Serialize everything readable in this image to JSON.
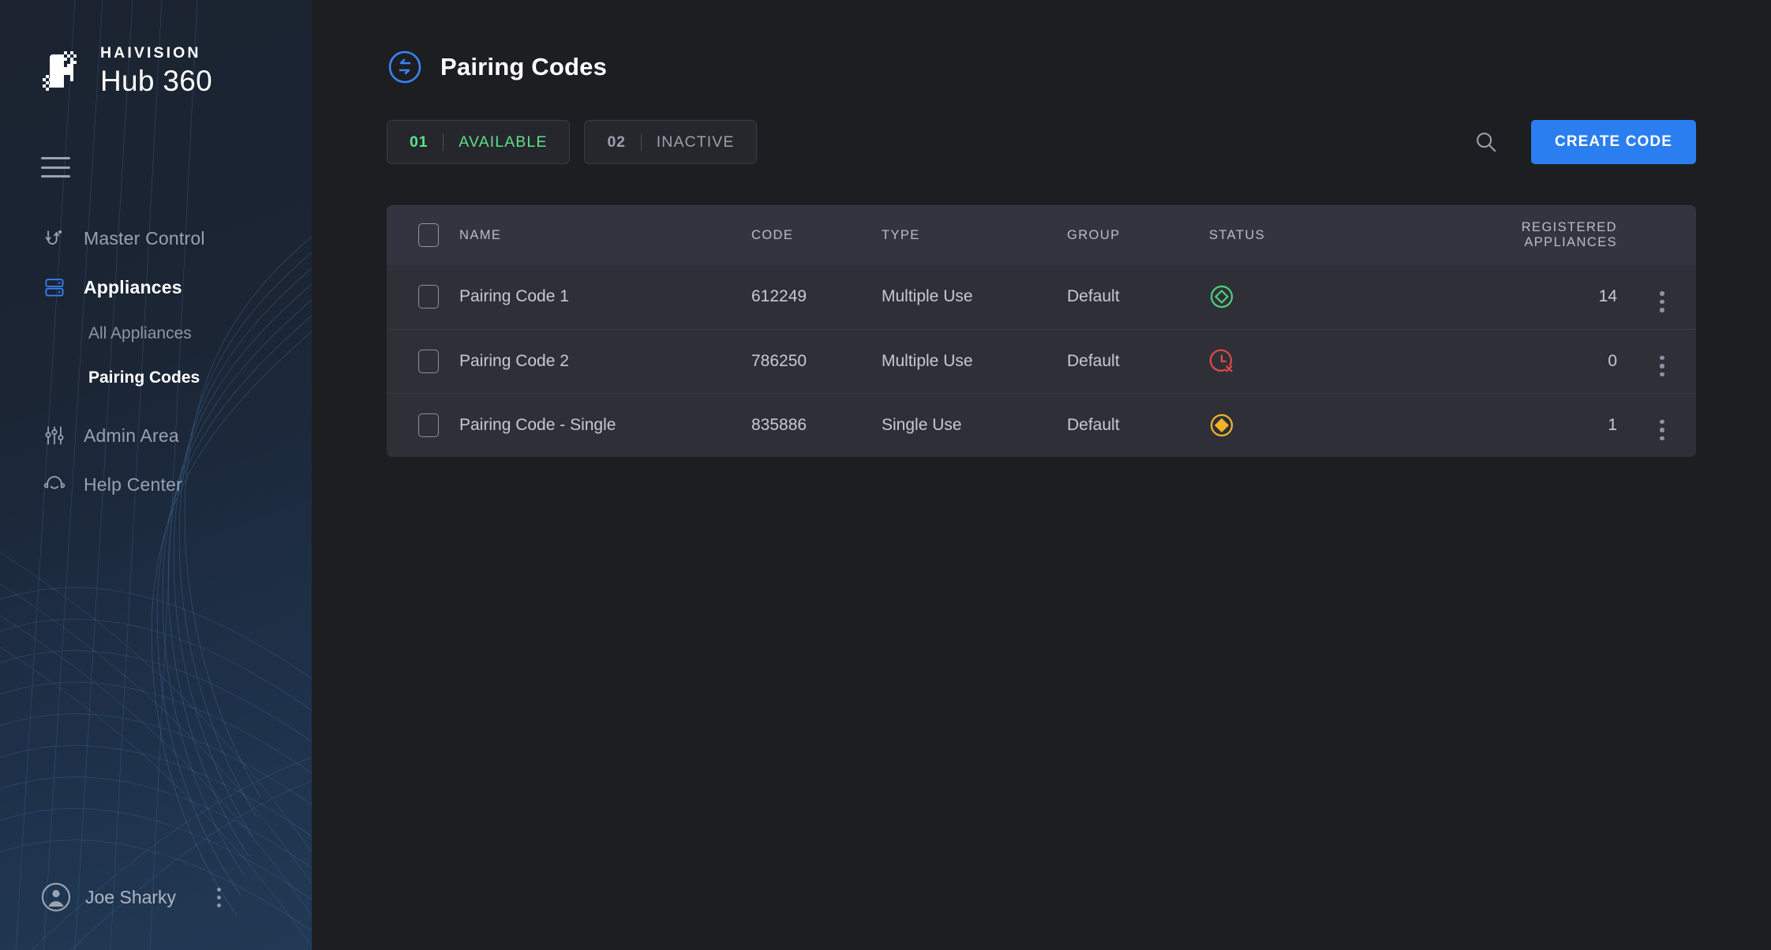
{
  "sidebar": {
    "logo": {
      "brand": "HAIVISION",
      "product": "Hub 360",
      "mark_icon": "haivision-h-logo"
    },
    "menu_toggle_icon": "hamburger-menu-icon",
    "items": [
      {
        "label": "Master Control",
        "icon": "routing-swap-icon",
        "active": false
      },
      {
        "label": "Appliances",
        "icon": "server-stack-icon",
        "active": true
      },
      {
        "label": "Admin Area",
        "icon": "sliders-icon",
        "active": false
      },
      {
        "label": "Help Center",
        "icon": "headset-icon",
        "active": false
      }
    ],
    "sub_items": [
      {
        "label": "All Appliances",
        "active": false
      },
      {
        "label": "Pairing Codes",
        "active": true
      }
    ],
    "user": {
      "name": "Joe Sharky",
      "avatar_icon": "user-avatar-icon",
      "menu_icon": "kebab-menu-icon"
    }
  },
  "header": {
    "title": "Pairing Codes",
    "icon": "pairing-exchange-icon"
  },
  "toolbar": {
    "chips": [
      {
        "count": "01",
        "label": "AVAILABLE",
        "color": "#5ce08b"
      },
      {
        "count": "02",
        "label": "INACTIVE",
        "color": "#9aa0ad"
      }
    ],
    "search_icon": "search-icon",
    "create_label": "CREATE CODE",
    "create_color": "#2b7ef0"
  },
  "table": {
    "columns": [
      "NAME",
      "CODE",
      "TYPE",
      "GROUP",
      "STATUS",
      "REGISTERED APPLIANCES"
    ],
    "select_all_icon": "checkbox-unchecked-icon",
    "rows": [
      {
        "name": "Pairing Code 1",
        "code": "612249",
        "type": "Multiple Use",
        "group": "Default",
        "status": "active",
        "status_icon": "diamond-outline-circle-icon",
        "status_color": "#4ed07e",
        "registered": "14",
        "menu_icon": "kebab-menu-icon"
      },
      {
        "name": "Pairing Code 2",
        "code": "786250",
        "type": "Multiple Use",
        "group": "Default",
        "status": "expired",
        "status_icon": "clock-x-icon",
        "status_color": "#e04a4a",
        "registered": "0",
        "menu_icon": "kebab-menu-icon"
      },
      {
        "name": "Pairing Code - Single",
        "code": "835886",
        "type": "Single Use",
        "group": "Default",
        "status": "used",
        "status_icon": "diamond-filled-circle-icon",
        "status_color": "#f0b429",
        "registered": "1",
        "menu_icon": "kebab-menu-icon"
      }
    ]
  }
}
